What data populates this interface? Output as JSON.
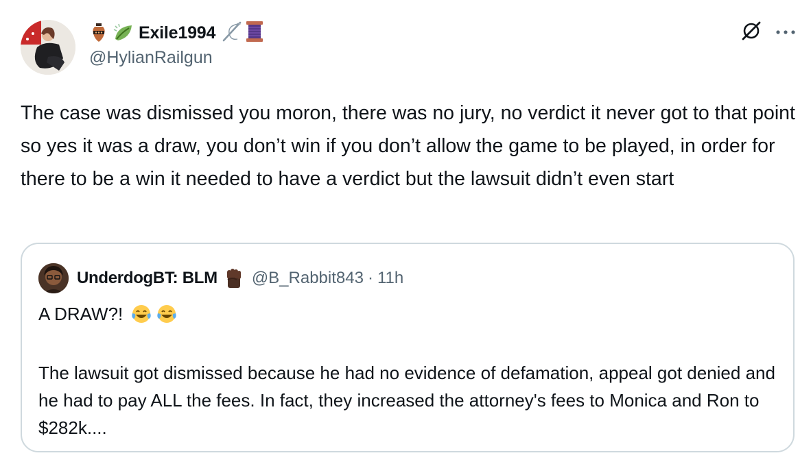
{
  "post": {
    "display_name": "Exile1994",
    "handle": "@HylianRailgun",
    "text": "The case was dismissed you moron, there was no jury, no verdict it never got to that point so yes it was a draw, you don’t win if you don’t allow the game to be played, in order for there to be a win it needed to have a verdict but the lawsuit didn’t even start",
    "icons": [
      "amphora-icon",
      "leaf-icon",
      "needle-icon",
      "thread-spool-icon",
      "grok-icon",
      "more-icon"
    ]
  },
  "quote": {
    "display_name": "UnderdogBT: BLM",
    "handle": "@B_Rabbit843",
    "separator": "·",
    "time": "11h",
    "first_line": "A DRAW?!",
    "body": "The lawsuit got dismissed because he had no evidence of defamation, appeal got denied and he had to pay ALL the fees. In fact, they increased the attorney's fees to Monica and Ron to $282k....",
    "icons": [
      "raised-fist-icon",
      "tears-of-joy-icon"
    ]
  },
  "colors": {
    "text": "#0f1419",
    "secondary": "#536471",
    "border": "#cfd9de",
    "background": "#ffffff"
  }
}
